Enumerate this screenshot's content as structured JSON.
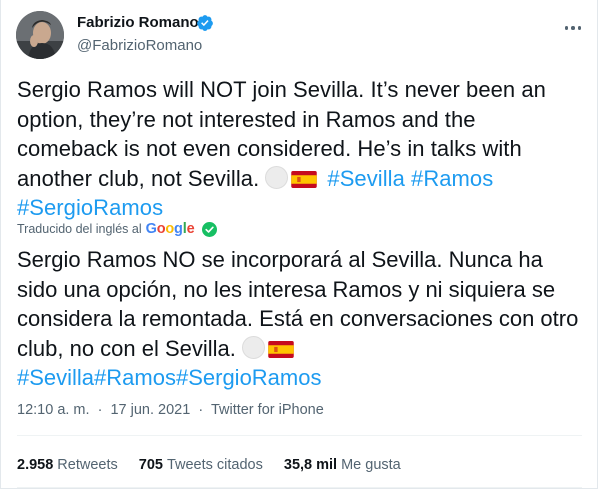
{
  "author": {
    "name": "Fabrizio Romano",
    "handle": "@FabrizioRomano"
  },
  "tweet": {
    "text_plain": "Sergio Ramos will NOT join Sevilla. It’s never been an option, they’re not interested in Ramos and the comeback is not even considered. He’s in talks with another club, not Sevilla.",
    "hashtag_sevilla": "#Sevilla",
    "hashtag_ramos": "#Ramos",
    "hashtag_sergioramos": "#SergioRamos"
  },
  "translation": {
    "label": "Traducido del inglés al",
    "provider": "Google",
    "text_plain": "Sergio Ramos NO se incorporará al Sevilla. Nunca ha sido una opción, no les interesa Ramos y ni siquiera se considera la remontada. Está en conversaciones con otro club, no con el Sevilla.",
    "hashtag_sevilla": "#Sevilla",
    "hashtag_ramos": "#Ramos",
    "hashtag_sergioramos": "#SergioRamos"
  },
  "meta": {
    "time": "12:10 a. m.",
    "separator": "·",
    "date": "17 jun. 2021",
    "source": "Twitter for iPhone"
  },
  "stats": {
    "retweets_count": "2.958",
    "retweets_label": "Retweets",
    "quotes_count": "705",
    "quotes_label": "Tweets citados",
    "likes_count": "35,8 mil",
    "likes_label": "Me gusta"
  },
  "colors": {
    "link": "#1d9bf0",
    "verified": "#1d9bf0",
    "secondary_text": "#536471"
  },
  "icons": {
    "verified": "verified-badge-icon",
    "more": "more-options-icon",
    "check": "check-circle-icon",
    "flag": "spain-flag-icon"
  }
}
